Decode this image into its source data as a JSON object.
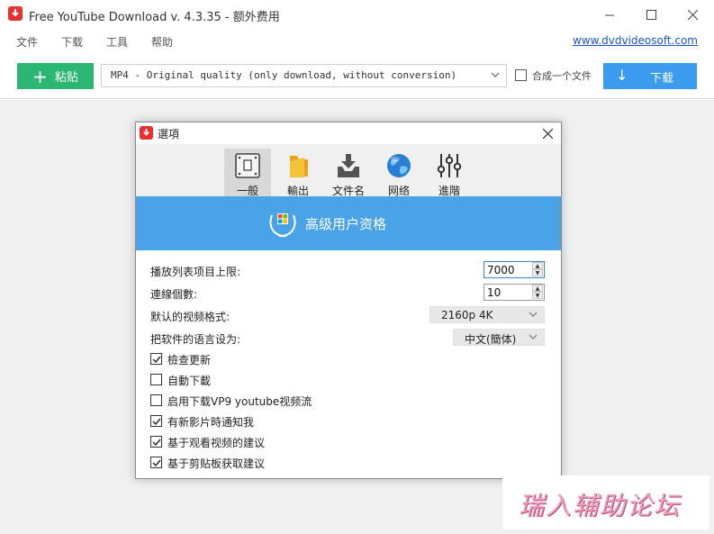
{
  "window": {
    "title": "Free YouTube Download v. 4.3.35 - 额外费用",
    "minimize": "—",
    "maximize": "☐",
    "close": "✕"
  },
  "menu": {
    "items": [
      {
        "label": "文件"
      },
      {
        "label": "下载"
      },
      {
        "label": "工具"
      },
      {
        "label": "帮助"
      }
    ],
    "site_link": "www.dvdvideosoft.com"
  },
  "toolbar": {
    "paste_label": "粘贴",
    "paste_icon": "+",
    "format_value": "MP4 - Original quality (only download, without conversion)",
    "format_chevron": "⌄",
    "combine_label": "合成一个文件",
    "combine_checked": false,
    "download_label": "下载",
    "download_arrow": "↓"
  },
  "dialog": {
    "title": "選項",
    "close": "✕",
    "tabs": [
      {
        "label": "一般",
        "icon": "general-icon",
        "active": true
      },
      {
        "label": "輸出",
        "icon": "folder-icon",
        "active": false
      },
      {
        "label": "文件名",
        "icon": "filename-icon",
        "active": false
      },
      {
        "label": "网络",
        "icon": "globe-icon",
        "active": false
      },
      {
        "label": "進階",
        "icon": "sliders-icon",
        "active": false
      }
    ],
    "premium_text": "高级用户资格",
    "settings": {
      "playlist_limit_label": "播放列表项目上限:",
      "playlist_limit_value": "7000",
      "connections_label": "連線個數:",
      "connections_value": "10",
      "default_format_label": "默认的视频格式:",
      "default_format_value": "2160p 4K",
      "language_label": "把软件的语言设为:",
      "language_value": "中文(簡体)"
    },
    "checkboxes": [
      {
        "label": "檢查更新",
        "checked": true
      },
      {
        "label": "自動下載",
        "checked": false
      },
      {
        "label": "启用下载VP9 youtube视频流",
        "checked": false
      },
      {
        "label": "有新影片時通知我",
        "checked": true
      },
      {
        "label": "基于观看视频的建议",
        "checked": true
      },
      {
        "label": "基于剪贴板获取建议",
        "checked": true
      }
    ]
  },
  "watermark": {
    "text": "瑞入辅助论坛"
  },
  "colors": {
    "accent_green": "#2bb673",
    "accent_blue": "#3a9bef",
    "banner_blue": "#4aa3e6",
    "brand_red": "#e8302e"
  }
}
